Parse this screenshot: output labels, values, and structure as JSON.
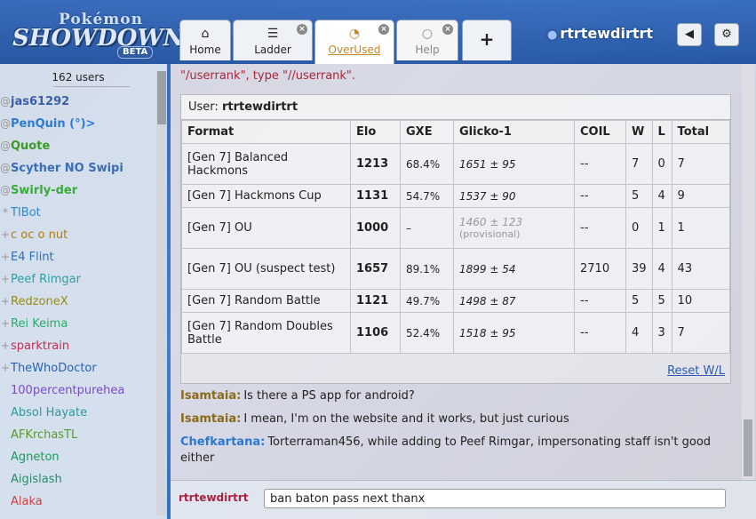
{
  "logo": {
    "line1": "Pokémon",
    "line2": "SHOWDOWN",
    "badge": "BETA"
  },
  "tabs": [
    {
      "label": "Home",
      "icon": "home-icon",
      "glyph": "⌂",
      "closable": false
    },
    {
      "label": "Ladder",
      "icon": "list-icon",
      "glyph": "☰",
      "closable": true
    },
    {
      "label": "OverUsed",
      "icon": "chat-bubbles-icon",
      "glyph": "💬",
      "closable": true,
      "active": true
    },
    {
      "label": "Help",
      "icon": "speech-bubble-icon",
      "glyph": "○",
      "closable": true
    },
    {
      "label": "",
      "icon": "plus-icon",
      "glyph": "+",
      "closable": false
    }
  ],
  "header": {
    "username": "rtrtewdirtrt",
    "sound_glyph": "◀",
    "options_glyph": "⚙"
  },
  "userlist": {
    "count": "162 users",
    "users": [
      {
        "rank": "@",
        "name": "jas61292",
        "color": "#3a5fa8",
        "bold": true
      },
      {
        "rank": "@",
        "name": "PenQuin (°)>",
        "color": "#2c7bd8",
        "bold": true
      },
      {
        "rank": "@",
        "name": "Quote",
        "color": "#3a9a2a",
        "bold": true
      },
      {
        "rank": "@",
        "name": "Scyther NO Swipi",
        "color": "#3a6db8",
        "bold": true
      },
      {
        "rank": "@",
        "name": "Swirly-der",
        "color": "#3aaa3a",
        "bold": true
      },
      {
        "rank": "*",
        "name": "TIBot",
        "color": "#2e8ad8",
        "bold": false
      },
      {
        "rank": "+",
        "name": "c oc o nut",
        "color": "#b27a10",
        "bold": false
      },
      {
        "rank": "+",
        "name": "E4 Flint",
        "color": "#2a70c0",
        "bold": false
      },
      {
        "rank": "+",
        "name": "Peef Rimgar",
        "color": "#2aa0a0",
        "bold": false
      },
      {
        "rank": "+",
        "name": "RedzoneX",
        "color": "#9a8a10",
        "bold": false
      },
      {
        "rank": "+",
        "name": "Rei Keima",
        "color": "#2aaa6a",
        "bold": false
      },
      {
        "rank": "+",
        "name": "sparktrain",
        "color": "#c03050",
        "bold": false
      },
      {
        "rank": "+",
        "name": "TheWhoDoctor",
        "color": "#2a60b8",
        "bold": false
      },
      {
        "rank": " ",
        "name": "100percentpurehea",
        "color": "#7a4ac8",
        "bold": false
      },
      {
        "rank": " ",
        "name": "Absol Hayate",
        "color": "#2a9a9a",
        "bold": false
      },
      {
        "rank": " ",
        "name": "AFKrchasTL",
        "color": "#5a9a2a",
        "bold": false
      },
      {
        "rank": " ",
        "name": "Agneton",
        "color": "#1a9a5a",
        "bold": false
      },
      {
        "rank": " ",
        "name": "Aigislash",
        "color": "#2a8a6a",
        "bold": false
      },
      {
        "rank": " ",
        "name": "Alaka",
        "color": "#d04040",
        "bold": false
      }
    ]
  },
  "chat": {
    "intro": "\"/userrank\", type \"//userrank\".",
    "rank": {
      "user_label": "User:",
      "user_name": "rtrtewdirtrt",
      "columns": [
        "Format",
        "Elo",
        "GXE",
        "Glicko-1",
        "COIL",
        "W",
        "L",
        "Total"
      ],
      "rows": [
        {
          "format": "[Gen 7] Balanced Hackmons",
          "elo": "1213",
          "gxe": "68.4%",
          "glicko": "1651 ± 95",
          "provisional": "",
          "coil": "--",
          "w": "7",
          "l": "0",
          "total": "7"
        },
        {
          "format": "[Gen 7] Hackmons Cup",
          "elo": "1131",
          "gxe": "54.7%",
          "glicko": "1537 ± 90",
          "provisional": "",
          "coil": "--",
          "w": "5",
          "l": "4",
          "total": "9"
        },
        {
          "format": "[Gen 7] OU",
          "elo": "1000",
          "gxe": "–",
          "glicko": "1460 ± 123",
          "provisional": "(provisional)",
          "coil": "--",
          "w": "0",
          "l": "1",
          "total": "1"
        },
        {
          "format": "[Gen 7] OU (suspect test)",
          "elo": "1657",
          "gxe": "89.1%",
          "glicko": "1899 ± 54",
          "provisional": "",
          "coil": "2710",
          "w": "39",
          "l": "4",
          "total": "43"
        },
        {
          "format": "[Gen 7] Random Battle",
          "elo": "1121",
          "gxe": "49.7%",
          "glicko": "1498 ± 87",
          "provisional": "",
          "coil": "--",
          "w": "5",
          "l": "5",
          "total": "10"
        },
        {
          "format": "[Gen 7] Random Doubles Battle",
          "elo": "1106",
          "gxe": "52.4%",
          "glicko": "1518 ± 95",
          "provisional": "",
          "coil": "--",
          "w": "4",
          "l": "3",
          "total": "7"
        }
      ],
      "reset_label": "Reset W/L"
    },
    "messages": [
      {
        "author": "Isamtaia:",
        "color": "#8a6a1a",
        "text": "Is there a PS app for android?"
      },
      {
        "author": "Isamtaia:",
        "color": "#8a6a1a",
        "text": "I mean, I'm on the website and it works, but just curious"
      },
      {
        "author": "Chefkartana:",
        "color": "#2a78d0",
        "text": "Torterraman456, while adding to Peef Rimgar, impersonating staff isn't good either"
      }
    ]
  },
  "input": {
    "name": "rtrtewdirtrt",
    "value": "ban baton pass next thanx"
  }
}
